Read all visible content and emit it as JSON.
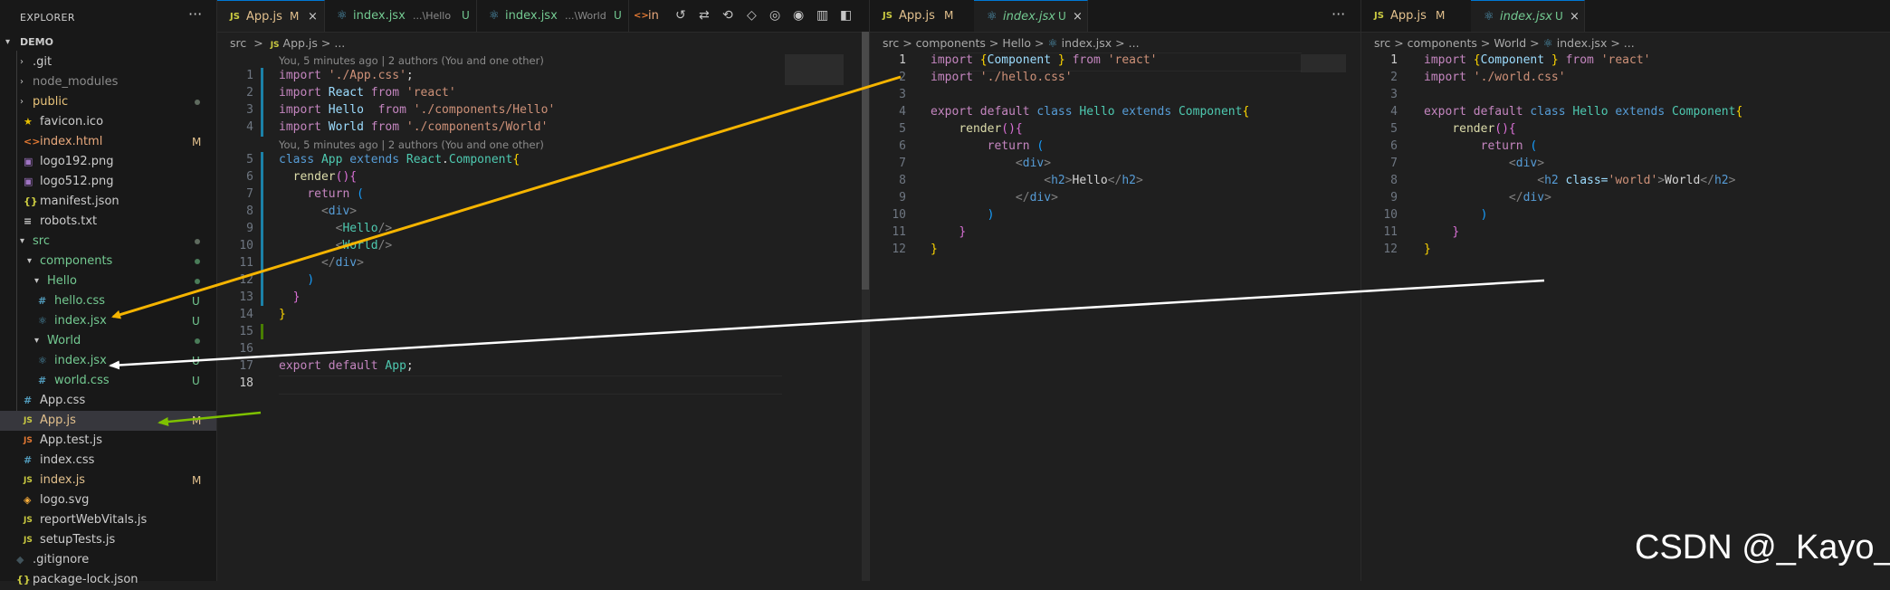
{
  "explorer": {
    "title": "EXPLORER",
    "more": "···",
    "items": [
      {
        "label": "DEMO",
        "badge": ""
      },
      {
        "label": ".git",
        "badge": ""
      },
      {
        "label": "node_modules",
        "badge": ""
      },
      {
        "label": "public",
        "badge": ""
      },
      {
        "label": "favicon.ico",
        "badge": ""
      },
      {
        "label": "index.html",
        "badge": "M"
      },
      {
        "label": "logo192.png",
        "badge": ""
      },
      {
        "label": "logo512.png",
        "badge": ""
      },
      {
        "label": "manifest.json",
        "badge": ""
      },
      {
        "label": "robots.txt",
        "badge": ""
      },
      {
        "label": "src",
        "badge": ""
      },
      {
        "label": "components",
        "badge": ""
      },
      {
        "label": "Hello",
        "badge": ""
      },
      {
        "label": "hello.css",
        "badge": "U"
      },
      {
        "label": "index.jsx",
        "badge": "U"
      },
      {
        "label": "World",
        "badge": ""
      },
      {
        "label": "index.jsx",
        "badge": "U"
      },
      {
        "label": "world.css",
        "badge": "U"
      },
      {
        "label": "App.css",
        "badge": ""
      },
      {
        "label": "App.js",
        "badge": "M"
      },
      {
        "label": "App.test.js",
        "badge": ""
      },
      {
        "label": "index.css",
        "badge": ""
      },
      {
        "label": "index.js",
        "badge": "M"
      },
      {
        "label": "logo.svg",
        "badge": ""
      },
      {
        "label": "reportWebVitals.js",
        "badge": ""
      },
      {
        "label": "setupTests.js",
        "badge": ""
      },
      {
        "label": ".gitignore",
        "badge": ""
      },
      {
        "label": "package-lock.json",
        "badge": ""
      }
    ]
  },
  "group1": {
    "tabs": [
      {
        "icon": "JS",
        "label": "App.js",
        "badge": "M",
        "close": "×"
      },
      {
        "label": "index.jsx",
        "desc": "...\\Hello",
        "badge": "U"
      },
      {
        "label": "index.jsx",
        "desc": "...\\World",
        "badge": "U"
      },
      {
        "label": "in"
      }
    ],
    "breadcrumb": {
      "folder": "src",
      "sep": ">",
      "icon": "JS",
      "file": "App.js",
      "rest": "> ..."
    },
    "blame1": "You, 5 minutes ago | 2 authors (You and one other)",
    "blame2": "You, 5 minutes ago | 2 authors (You and one other)",
    "code": [
      "import './App.css';",
      "import React from 'react'",
      "import Hello  from './components/Hello'",
      "import World from './components/World'",
      "class App extends React.Component{",
      "  render(){",
      "    return (",
      "      <div>",
      "        <Hello/>",
      "        <World/>",
      "      </div>",
      "    )",
      "  }",
      "}",
      "",
      "",
      "export default App;",
      ""
    ],
    "line_numbers": [
      "1",
      "2",
      "3",
      "4",
      "5",
      "6",
      "7",
      "8",
      "9",
      "10",
      "11",
      "12",
      "13",
      "14",
      "15",
      "16",
      "17",
      "18"
    ]
  },
  "group2": {
    "tabs": [
      {
        "icon": "JS",
        "label": "App.js",
        "badge": "M"
      },
      {
        "label": "index.jsx",
        "badge": "U",
        "close": "×"
      }
    ],
    "more": "···",
    "breadcrumb": {
      "p1": "src",
      "p2": "components",
      "p3": "Hello",
      "file": "index.jsx",
      "rest": "..."
    },
    "line_numbers": [
      "1",
      "2",
      "3",
      "4",
      "5",
      "6",
      "7",
      "8",
      "9",
      "10",
      "11",
      "12"
    ]
  },
  "group3": {
    "tabs": [
      {
        "icon": "JS",
        "label": "App.js",
        "badge": "M"
      },
      {
        "label": "index.jsx",
        "badge": "U",
        "close": "×"
      }
    ],
    "breadcrumb": {
      "p1": "src",
      "p2": "components",
      "p3": "World",
      "file": "index.jsx",
      "rest": "..."
    },
    "line_numbers": [
      "1",
      "2",
      "3",
      "4",
      "5",
      "6",
      "7",
      "8",
      "9",
      "10",
      "11",
      "12"
    ]
  },
  "code_tokens": {
    "import": "import",
    "from": "from",
    "export": "export",
    "default": "default",
    "class": "class",
    "extends": "extends",
    "render": "render",
    "return": "return",
    "Component": "Component",
    "Hello": "Hello",
    "World": "World",
    "react": "'react'",
    "hello_css": "'./hello.css'",
    "world_css": "'./world.css'",
    "div": "div",
    "h2": "h2",
    "class_attr": "class=",
    "world_str": "'world'"
  },
  "watermark": "CSDN @_Kayo_",
  "colors": {
    "keyword": "#c586c0",
    "string": "#ce9178",
    "class": "#4ec9b0",
    "arrow_orange": "#f5b400",
    "arrow_white": "#ffffff",
    "arrow_green": "#7ec100"
  }
}
